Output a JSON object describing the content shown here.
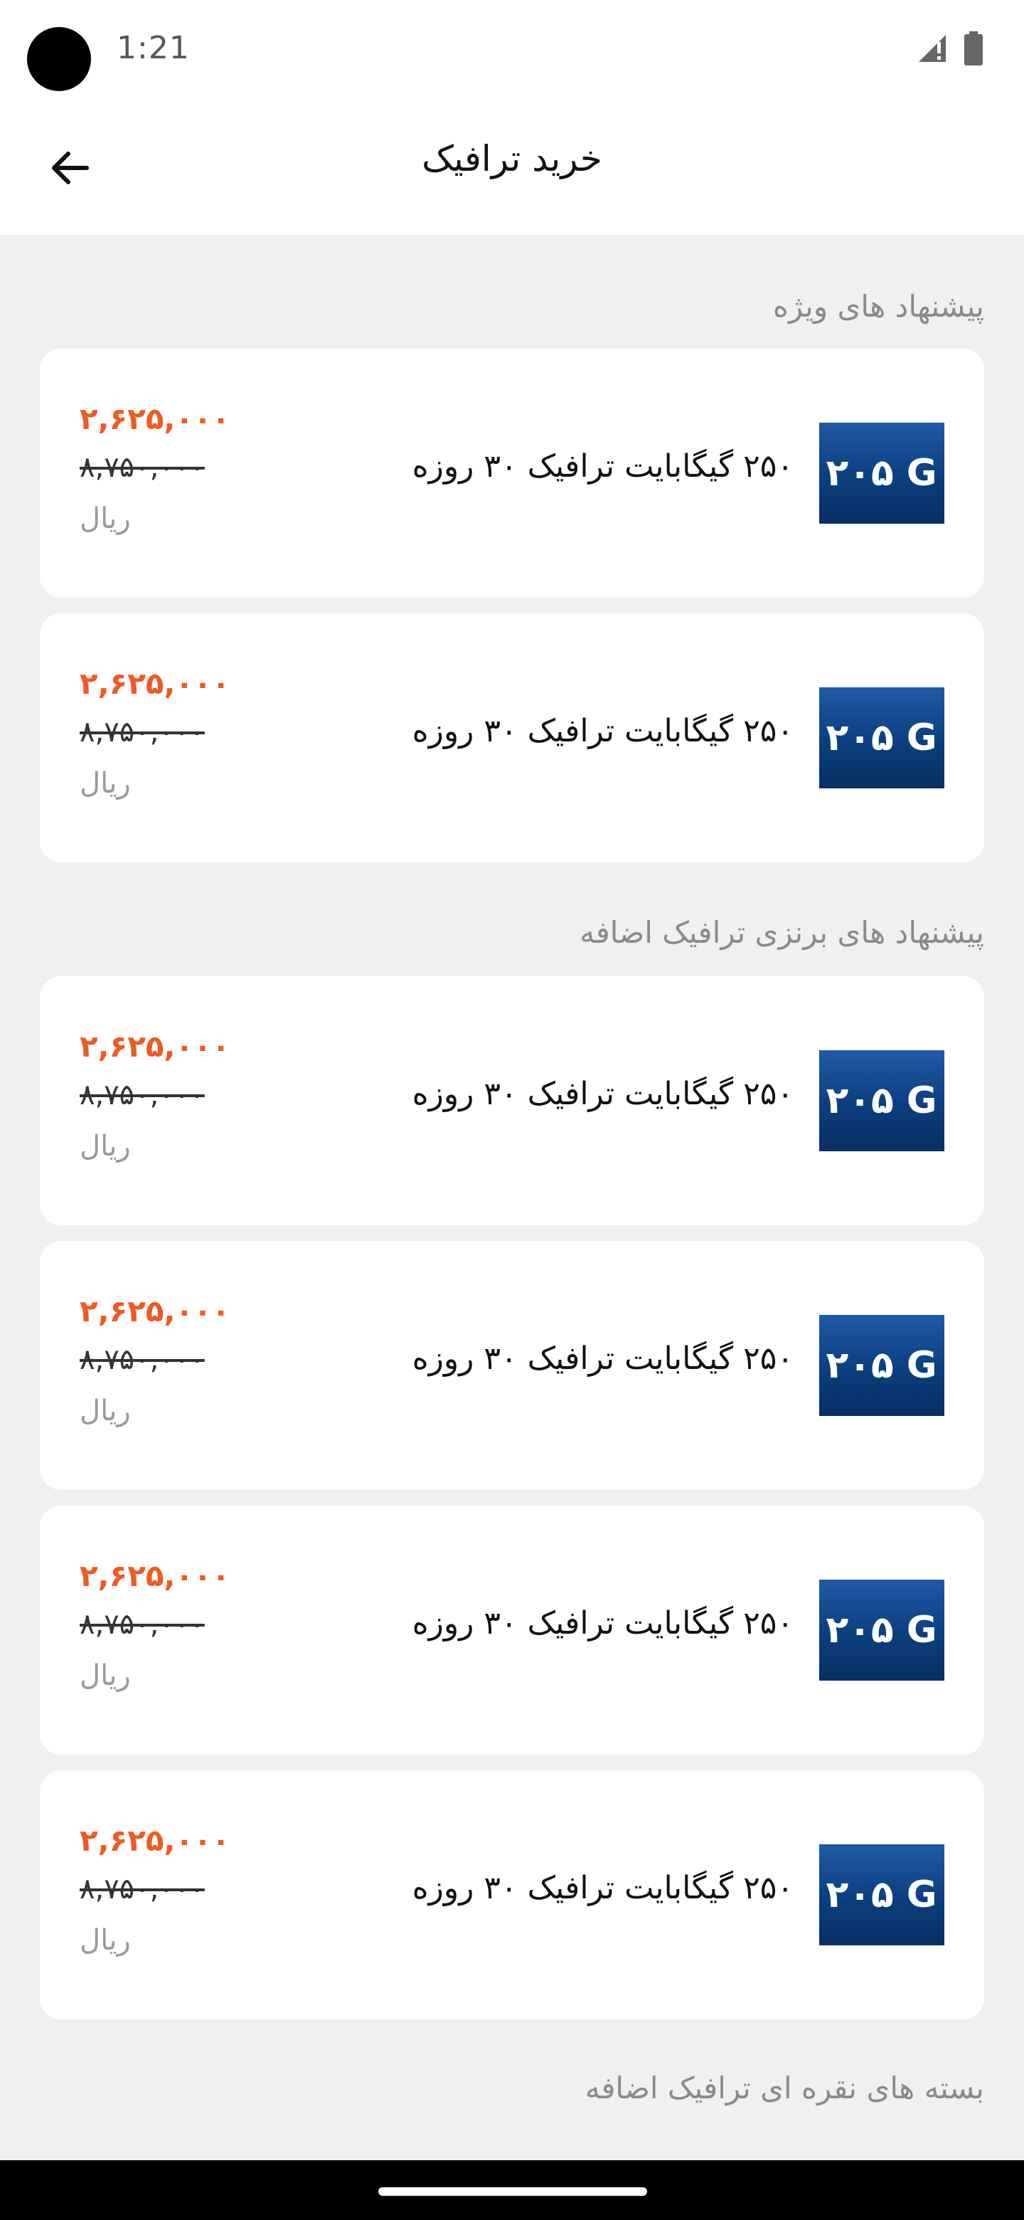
{
  "status_bar": {
    "time": "1:21"
  },
  "app_bar": {
    "title": "خرید ترافیک",
    "back_icon": "arrow-left-icon"
  },
  "sections": [
    {
      "title": "پیشنهاد های ویژه",
      "items": [
        {
          "thumb": "۲۰۵ G",
          "title": "۲۵۰ گیگابایت ترافیک ۳۰ روزه",
          "price_new": "۲,۶۲۵,۰۰۰",
          "price_old": "۸,۷۵۰,۰۰۰",
          "currency": "ریال"
        },
        {
          "thumb": "۲۰۵ G",
          "title": "۲۵۰ گیگابایت ترافیک ۳۰ روزه",
          "price_new": "۲,۶۲۵,۰۰۰",
          "price_old": "۸,۷۵۰,۰۰۰",
          "currency": "ریال"
        }
      ]
    },
    {
      "title": "پیشنهاد های برنزی ترافیک اضافه",
      "items": [
        {
          "thumb": "۲۰۵ G",
          "title": "۲۵۰ گیگابایت ترافیک ۳۰ روزه",
          "price_new": "۲,۶۲۵,۰۰۰",
          "price_old": "۸,۷۵۰,۰۰۰",
          "currency": "ریال"
        },
        {
          "thumb": "۲۰۵ G",
          "title": "۲۵۰ گیگابایت ترافیک ۳۰ روزه",
          "price_new": "۲,۶۲۵,۰۰۰",
          "price_old": "۸,۷۵۰,۰۰۰",
          "currency": "ریال"
        },
        {
          "thumb": "۲۰۵ G",
          "title": "۲۵۰ گیگابایت ترافیک ۳۰ روزه",
          "price_new": "۲,۶۲۵,۰۰۰",
          "price_old": "۸,۷۵۰,۰۰۰",
          "currency": "ریال"
        },
        {
          "thumb": "۲۰۵ G",
          "title": "۲۵۰ گیگابایت ترافیک ۳۰ روزه",
          "price_new": "۲,۶۲۵,۰۰۰",
          "price_old": "۸,۷۵۰,۰۰۰",
          "currency": "ریال"
        }
      ]
    },
    {
      "title": "بسته های نقره ای ترافیک اضافه",
      "items": []
    }
  ],
  "colors": {
    "accent": "#f05a22",
    "background": "#f0f0f0",
    "card": "#ffffff",
    "thumb": "#0b3e7f"
  }
}
